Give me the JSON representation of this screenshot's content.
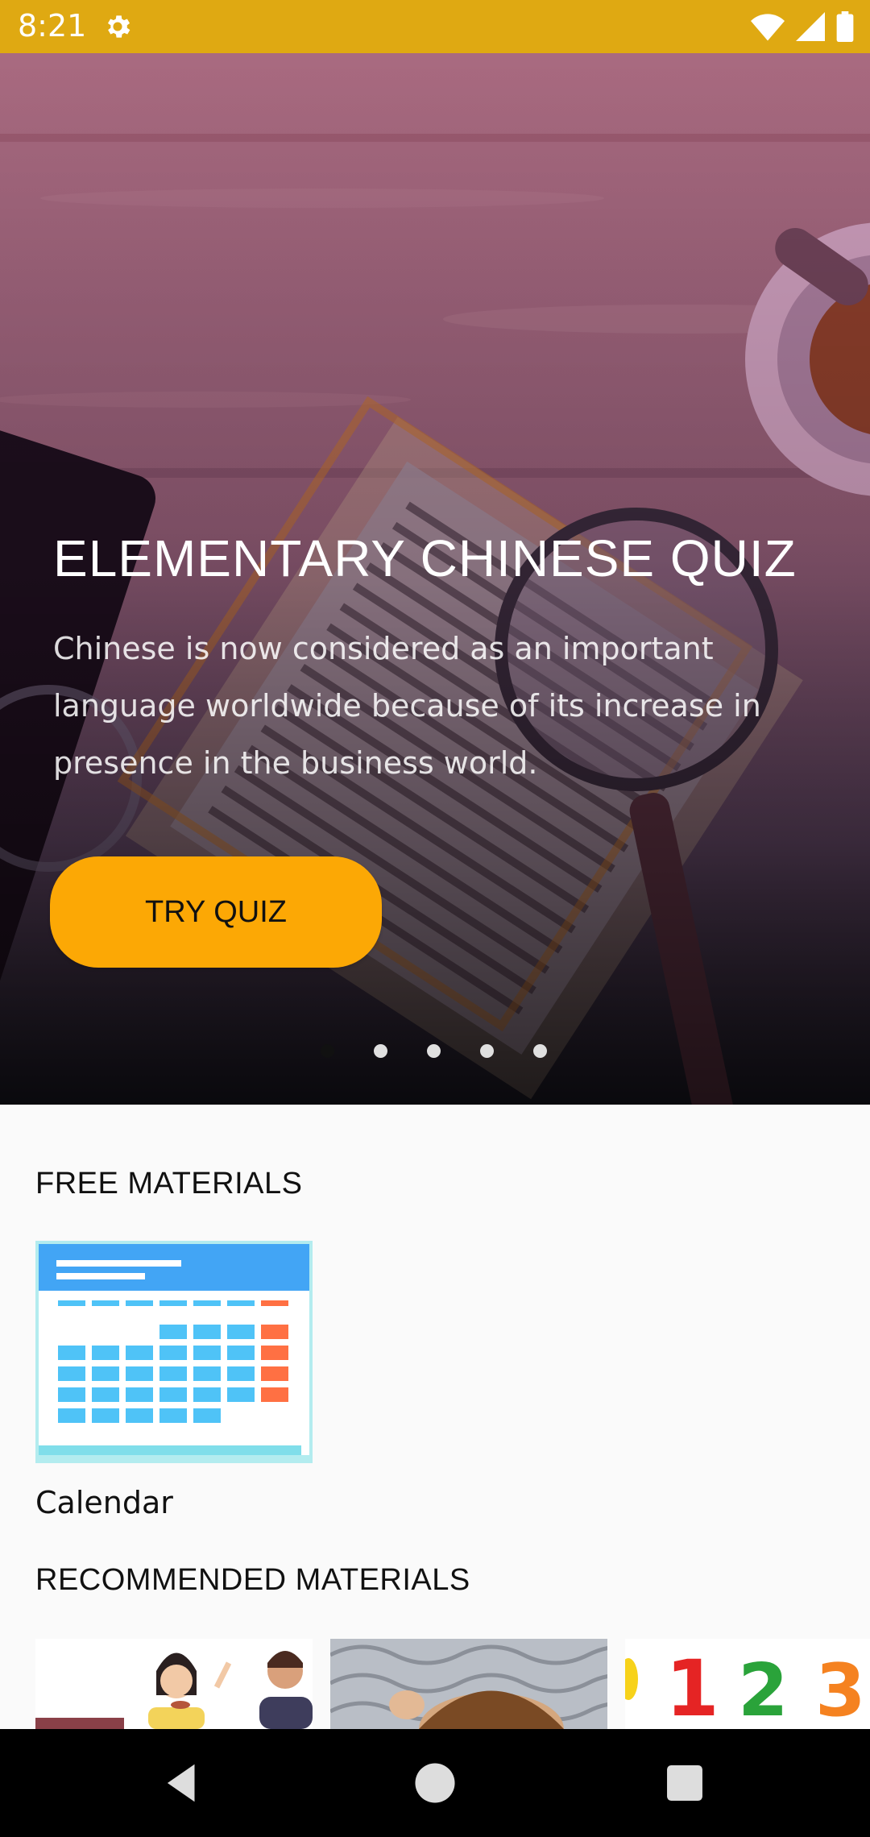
{
  "status_bar": {
    "time": "8:21",
    "icons": [
      "settings-gear-icon",
      "wifi-icon",
      "cellular-signal-icon",
      "battery-icon"
    ]
  },
  "hero": {
    "title": "ELEMENTARY CHINESE QUIZ",
    "description": "Chinese is now considered as an important language worldwide because of its increase in presence in the business world.",
    "button_label": "TRY QUIZ",
    "carousel": {
      "total_pages": 5,
      "current_page": 1
    }
  },
  "sections": {
    "free_materials_title": "FREE MATERIALS",
    "free_items": [
      {
        "label": "Calendar"
      }
    ],
    "recommended_title": "RECOMMENDED MATERIALS"
  },
  "colors": {
    "status_bar": "#dfa912",
    "button": "#fca805",
    "background": "#fafafa"
  },
  "navigation": [
    "back-icon",
    "home-icon",
    "recents-icon"
  ]
}
